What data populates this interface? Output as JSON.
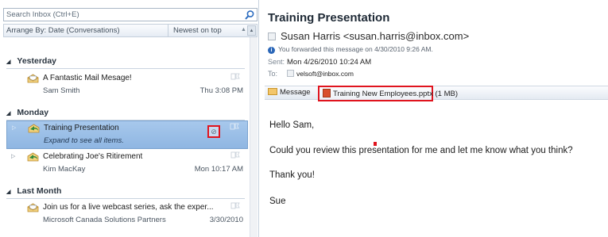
{
  "search": {
    "placeholder": "Search Inbox (Ctrl+E)"
  },
  "arrange": {
    "label": "Arrange By: Date (Conversations)",
    "sort": "Newest on top",
    "arrow": "▲"
  },
  "groups": [
    {
      "label": "Yesterday"
    },
    {
      "label": "Monday"
    },
    {
      "label": "Last Month"
    }
  ],
  "messages": [
    {
      "subject": "A Fantastic Mail Mesage!",
      "sender": "Sam Smith",
      "date": "Thu 3:08 PM"
    },
    {
      "subject": "Training Presentation",
      "sender": "Expand to see all items.",
      "date": "",
      "selected": true
    },
    {
      "subject": "Celebrating Joe's Ritirement",
      "sender": "Kim MacKay",
      "date": "Mon 10:17 AM"
    },
    {
      "subject": "Join us for a live webcast series, ask the exper...",
      "sender": "Microsoft Canada Solutions Partners",
      "date": "3/30/2010"
    }
  ],
  "reading": {
    "title": "Training Presentation",
    "from": "Susan Harris <susan.harris@inbox.com>",
    "info": "You forwarded this message on 4/30/2010 9:26 AM.",
    "sent_label": "Sent:",
    "sent_value": "Mon 4/26/2010 10:24 AM",
    "to_label": "To:",
    "to_value": "velsoft@inbox.com",
    "message_tab": "Message",
    "attachment": "Training New Employees.pptx (1 MB)",
    "body": [
      "Hello Sam,",
      "Could you review this presentation for me and let me know what you think?",
      "Thank you!",
      "Sue"
    ]
  },
  "colors": {
    "highlight": "#e0141e",
    "selected_row": "#9fc2ea"
  }
}
